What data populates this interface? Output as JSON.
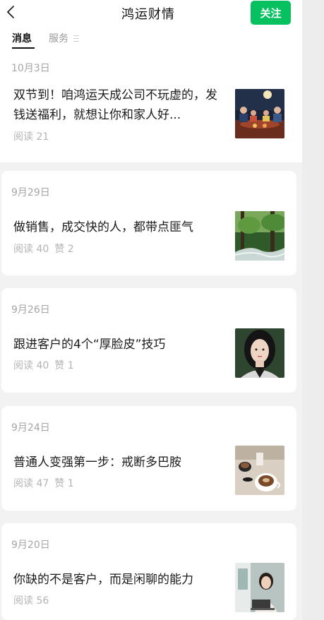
{
  "header": {
    "title": "鸿运财情",
    "follow_label": "关注"
  },
  "tabs": [
    {
      "label": "消息",
      "active": true
    },
    {
      "label": "服务",
      "active": false
    }
  ],
  "articles": [
    {
      "date": "10月3日",
      "title": "双节到！咱鸿运天成公司不玩虚的，发钱送福利，就想让你和家人好...",
      "reads": "阅读 21",
      "likes": "",
      "thumbnail": "family-dinner-under-moon"
    },
    {
      "date": "9月29日",
      "title": "做销售，成交快的人，都带点匪气",
      "reads": "阅读 40",
      "likes": "赞 2",
      "thumbnail": "forest-stream"
    },
    {
      "date": "9月26日",
      "title": "跟进客户的4个“厚脸皮”技巧",
      "reads": "阅读 40",
      "likes": "赞 1",
      "thumbnail": "woman-portrait"
    },
    {
      "date": "9月24日",
      "title": "普通人变强第一步：戒断多巴胺",
      "reads": "阅读 47",
      "likes": "赞 1",
      "thumbnail": "coffee-cups"
    },
    {
      "date": "9月20日",
      "title": "你缺的不是客户，而是闲聊的能力",
      "reads": "阅读 56",
      "likes": "",
      "thumbnail": "woman-at-laptop"
    }
  ],
  "colors": {
    "accent": "#07c160",
    "meta_text": "#b3b3b3",
    "feed_background": "#f2f2f2"
  }
}
